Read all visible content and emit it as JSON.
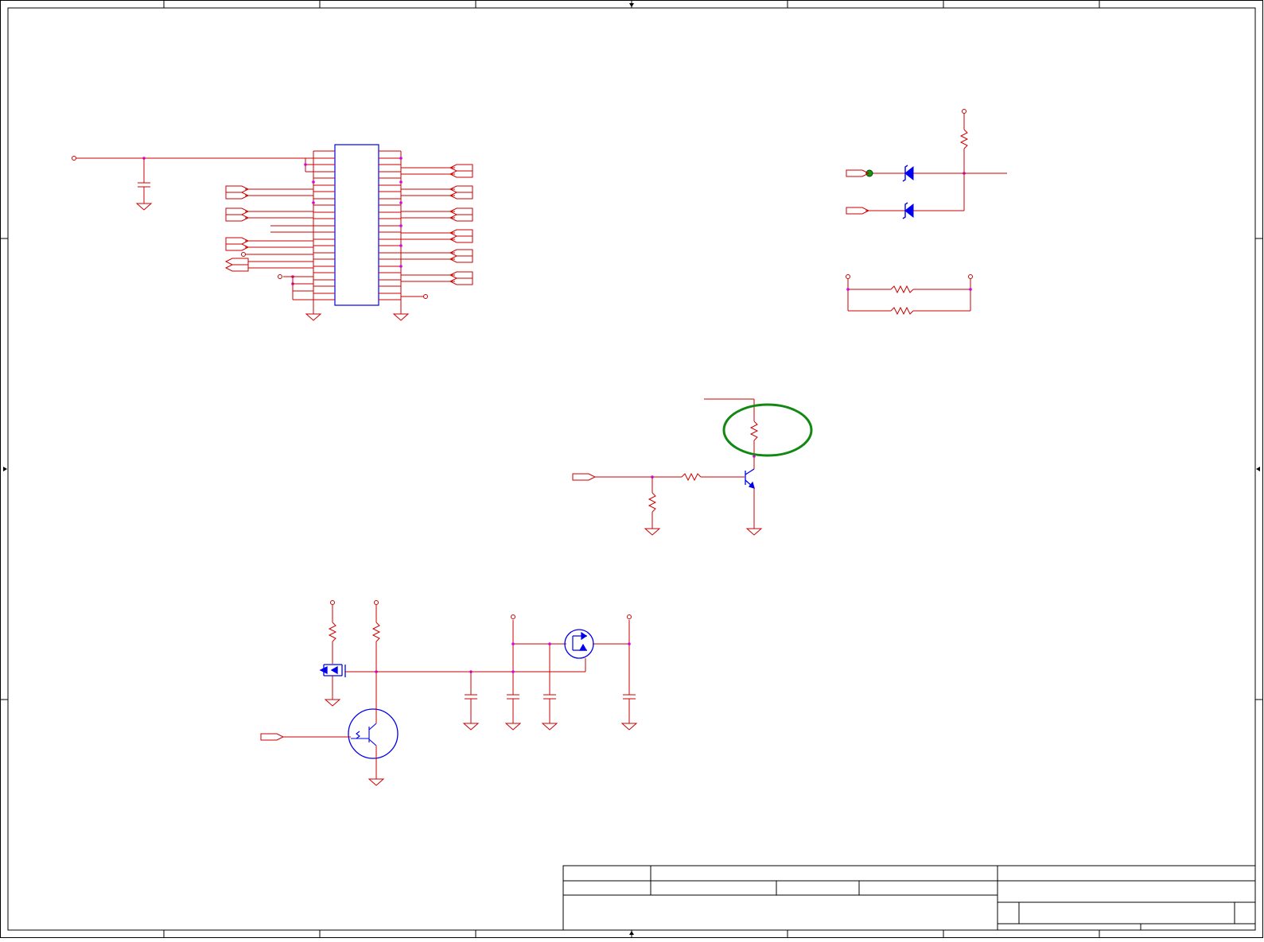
{
  "schematic": {
    "colors": {
      "wire": "#cc0000",
      "component": "#0000ee",
      "junction": "#dd00dd",
      "frame": "#000000",
      "highlight": "#008000",
      "pad": "#006600"
    },
    "frame": {
      "zone_markers": [
        "top",
        "bottom",
        "left",
        "right"
      ]
    },
    "regions": [
      {
        "id": "connector-block",
        "components": [
          "ic-connector",
          "decoupling-capacitor",
          "power-port",
          "ground-symbols",
          "offpage-connectors"
        ]
      },
      {
        "id": "diode-block",
        "components": [
          "zener-diode-1",
          "zener-diode-2",
          "pullup-resistor",
          "test-pad"
        ]
      },
      {
        "id": "parallel-resistors",
        "components": [
          "resistor-top",
          "resistor-bottom"
        ]
      },
      {
        "id": "transistor-switch",
        "components": [
          "npn-transistor",
          "base-resistor",
          "pulldown-resistor",
          "collector-resistor"
        ],
        "highlighted": "collector-resistor"
      },
      {
        "id": "power-switch",
        "components": [
          "digital-transistor",
          "nmos",
          "pmos",
          "capacitors",
          "pullup-resistors"
        ]
      }
    ],
    "title_block": {
      "cells": [
        "",
        "",
        "",
        "",
        "",
        "",
        "",
        "",
        ""
      ]
    }
  }
}
